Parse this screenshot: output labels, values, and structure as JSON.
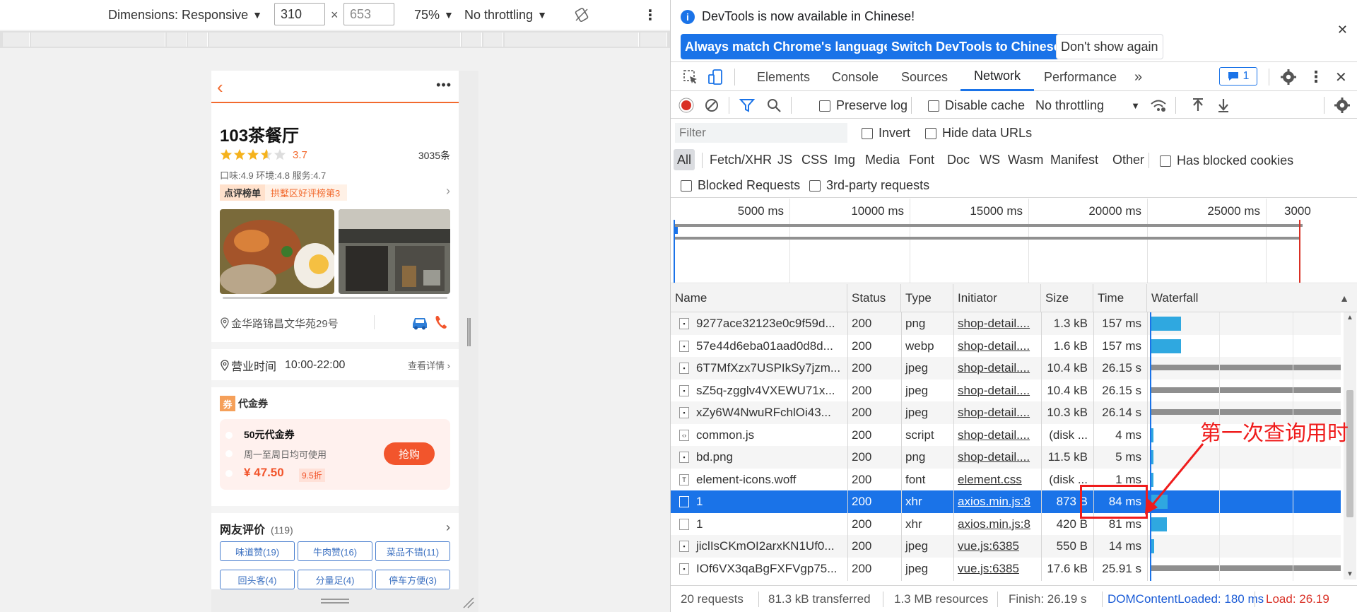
{
  "device_toolbar": {
    "dimensions_label": "Dimensions: Responsive",
    "width": "310",
    "height": "653",
    "times": "×",
    "zoom": "75%",
    "throttling": "No throttling"
  },
  "phone": {
    "shop_name": "103茶餐厅",
    "rating": "3.7",
    "review_count": "3035条",
    "subscores": "口味:4.9 环境:4.8 服务:4.7",
    "rank_badge": "点评榜单",
    "rank_text": "拱墅区好评榜第3",
    "address": "金华路锦昌文华苑29号",
    "hours_label": "营业时间",
    "hours": "10:00-22:00",
    "hours_link": "查看详情",
    "coupon_section": "代金券",
    "coupon_badge": "券",
    "coupon_name": "50元代金券",
    "coupon_desc": "周一至周日均可使用",
    "coupon_price": "¥ 47.50",
    "coupon_discount": "9.5折",
    "buy_label": "抢购",
    "reviews_title": "网友评价",
    "reviews_total": "(119)",
    "tags": [
      "味道赞(19)",
      "牛肉赞(16)",
      "菜品不错(11)",
      "回头客(4)",
      "分量足(4)",
      "停车方便(3)"
    ],
    "colors": {
      "accent": "#f26a2e",
      "price": "#f2552c",
      "tag": "#3a6fc0"
    }
  },
  "infobar": {
    "message": "DevTools is now available in Chinese!",
    "btn_match": "Always match Chrome's language",
    "btn_switch": "Switch DevTools to Chinese",
    "btn_dismiss": "Don't show again"
  },
  "tabs": [
    "Elements",
    "Console",
    "Sources",
    "Network",
    "Performance"
  ],
  "active_tab": "Network",
  "issues_count": "1",
  "network_toolbar": {
    "preserve_log": "Preserve log",
    "disable_cache": "Disable cache",
    "throttling": "No throttling"
  },
  "filter": {
    "placeholder": "Filter",
    "invert": "Invert",
    "hide_data_urls": "Hide data URLs",
    "types": [
      "All",
      "Fetch/XHR",
      "JS",
      "CSS",
      "Img",
      "Media",
      "Font",
      "Doc",
      "WS",
      "Wasm",
      "Manifest",
      "Other"
    ],
    "has_blocked_cookies": "Has blocked cookies",
    "blocked_requests": "Blocked Requests",
    "third_party": "3rd-party requests"
  },
  "overview_ticks": [
    "5000 ms",
    "10000 ms",
    "15000 ms",
    "20000 ms",
    "25000 ms",
    "3000"
  ],
  "columns": [
    "Name",
    "Status",
    "Type",
    "Initiator",
    "Size",
    "Time",
    "Waterfall"
  ],
  "requests": [
    {
      "name": "9277ace32123e0c9f59d...",
      "status": "200",
      "type": "png",
      "initiator": "shop-detail....",
      "size": "1.3 kB",
      "time": "157 ms",
      "start": 0.2,
      "dur": 157
    },
    {
      "name": "57e44d6eba01aad0d8d...",
      "status": "200",
      "type": "webp",
      "initiator": "shop-detail....",
      "size": "1.6 kB",
      "time": "157 ms",
      "start": 0.2,
      "dur": 157
    },
    {
      "name": "6T7MfXzx7USPIkSy7jzm...",
      "status": "200",
      "type": "jpeg",
      "initiator": "shop-detail....",
      "size": "10.4 kB",
      "time": "26.15 s",
      "start": 0.2,
      "dur": 26150
    },
    {
      "name": "sZ5q-zgglv4VXEWU71x...",
      "status": "200",
      "type": "jpeg",
      "initiator": "shop-detail....",
      "size": "10.4 kB",
      "time": "26.15 s",
      "start": 0.2,
      "dur": 26150
    },
    {
      "name": "xZy6W4NwuRFchlOi43...",
      "status": "200",
      "type": "jpeg",
      "initiator": "shop-detail....",
      "size": "10.3 kB",
      "time": "26.14 s",
      "start": 0.2,
      "dur": 26140
    },
    {
      "name": "common.js",
      "status": "200",
      "type": "script",
      "initiator": "shop-detail....",
      "size": "(disk ...",
      "time": "4 ms",
      "start": 0.2,
      "dur": 4
    },
    {
      "name": "bd.png",
      "status": "200",
      "type": "png",
      "initiator": "shop-detail....",
      "size": "11.5 kB",
      "time": "5 ms",
      "start": 0.2,
      "dur": 5
    },
    {
      "name": "element-icons.woff",
      "status": "200",
      "type": "font",
      "initiator": "element.css",
      "size": "(disk ...",
      "time": "1 ms",
      "start": 0.2,
      "dur": 1
    },
    {
      "name": "1",
      "status": "200",
      "type": "xhr",
      "initiator": "axios.min.js:8",
      "size": "873 B",
      "time": "84 ms",
      "start": 0.25,
      "dur": 84
    },
    {
      "name": "1",
      "status": "200",
      "type": "xhr",
      "initiator": "axios.min.js:8",
      "size": "420 B",
      "time": "81 ms",
      "start": 0.25,
      "dur": 81
    },
    {
      "name": "jiclIsCKmOI2arxKN1Uf0...",
      "status": "200",
      "type": "jpeg",
      "initiator": "vue.js:6385",
      "size": "550 B",
      "time": "14 ms",
      "start": 0.25,
      "dur": 14
    },
    {
      "name": "IOf6VX3qaBgFXFVgp75...",
      "status": "200",
      "type": "jpeg",
      "initiator": "vue.js:6385",
      "size": "17.6 kB",
      "time": "25.91 s",
      "start": 0.25,
      "dur": 25910
    }
  ],
  "selected_row": 8,
  "status": {
    "requests": "20 requests",
    "transferred": "81.3 kB transferred",
    "resources": "1.3 MB resources",
    "finish": "Finish: 26.19 s",
    "dcl": "DOMContentLoaded: 180 ms",
    "load": "Load: 26.19"
  },
  "annotation": {
    "text": "第一次查询用时",
    "color": "#ef1c1c"
  }
}
